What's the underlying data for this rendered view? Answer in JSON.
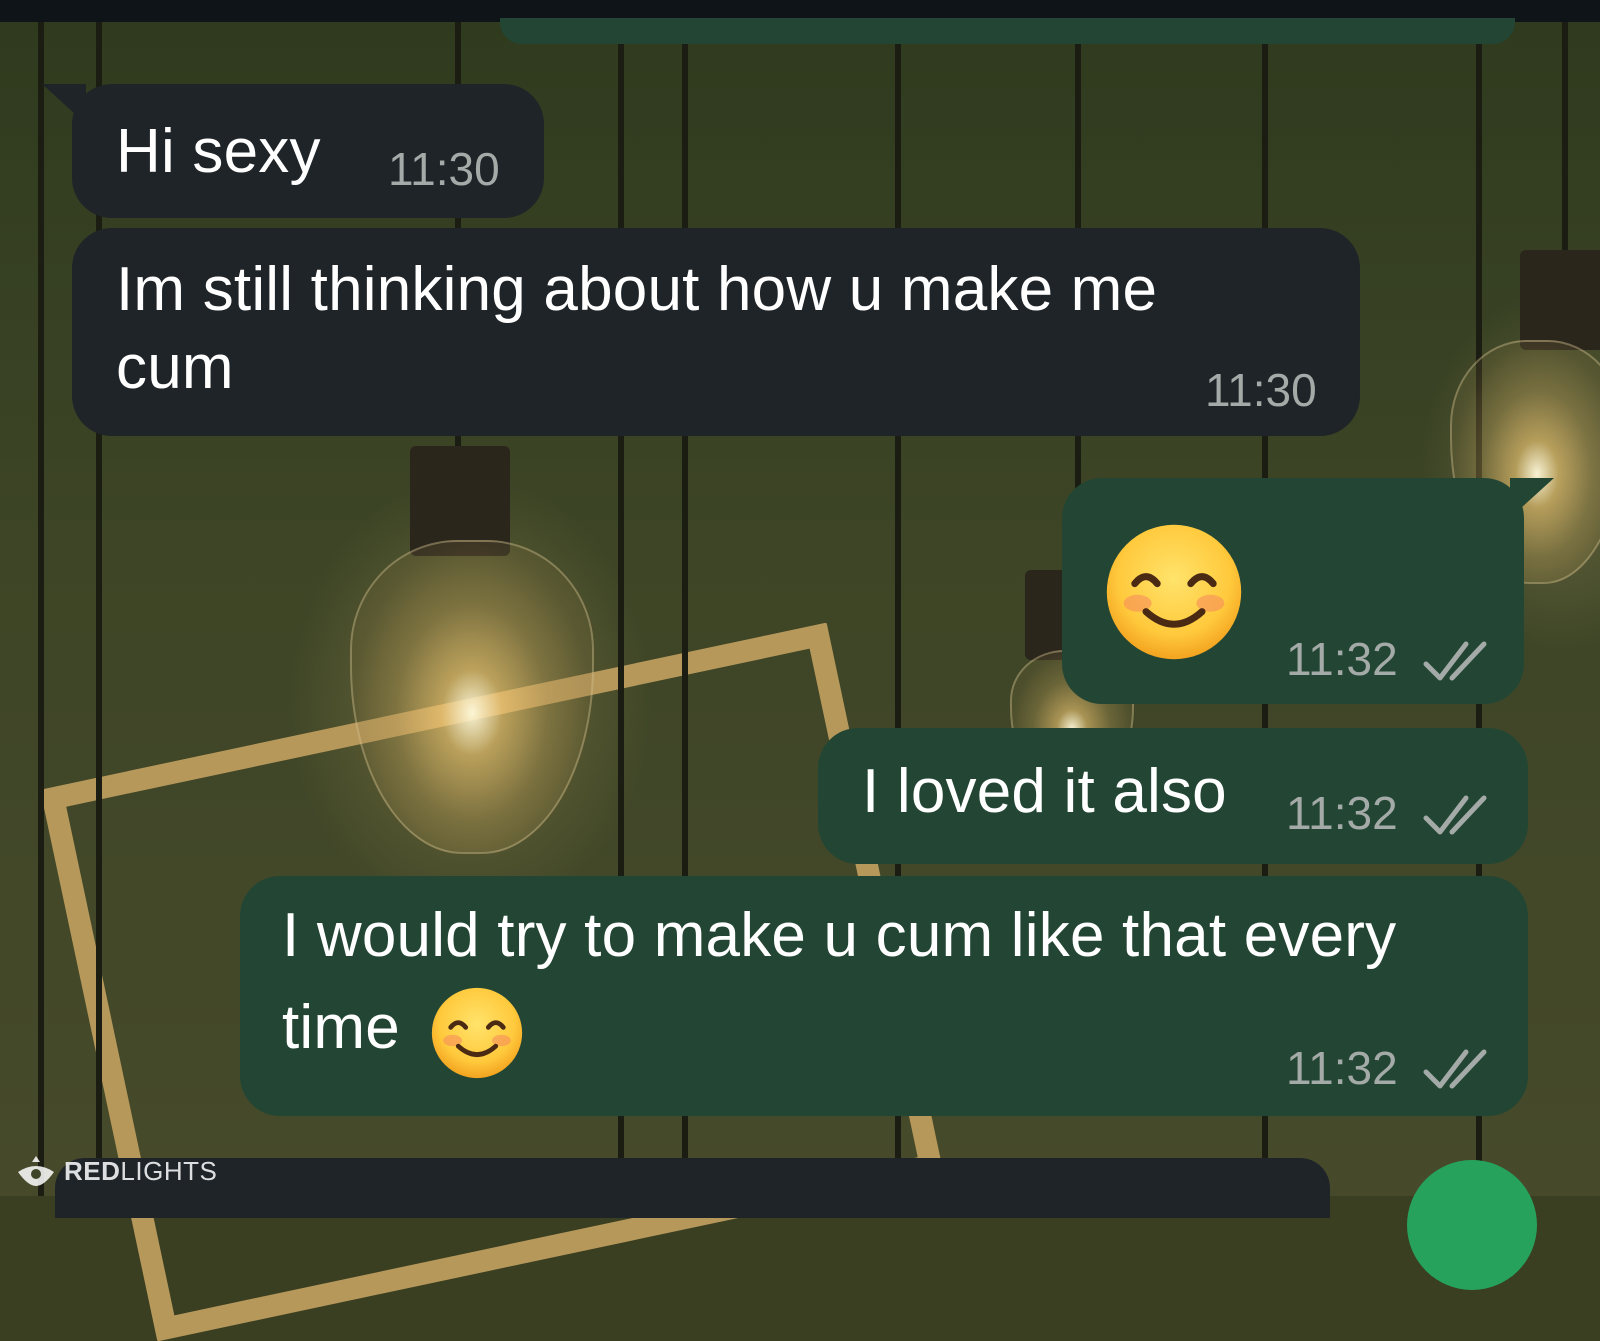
{
  "colors": {
    "incoming_bubble": "#1f2428",
    "outgoing_bubble": "#234634",
    "timestamp": "#a3aaa7",
    "send_button": "#27a25d"
  },
  "messages": [
    {
      "direction": "incoming",
      "text": "Hi sexy",
      "time": "11:30"
    },
    {
      "direction": "incoming",
      "line1": "Im still thinking about how u make me",
      "line2": "cum",
      "time": "11:30"
    },
    {
      "direction": "outgoing",
      "emoji": "smiling-face-with-smiling-eyes-icon",
      "time": "11:32",
      "status": "read"
    },
    {
      "direction": "outgoing",
      "text": "I loved it also",
      "time": "11:32",
      "status": "read"
    },
    {
      "direction": "outgoing",
      "line1": "I would try to make u cum like that every",
      "line2": "time",
      "emoji": "smiling-face-with-smiling-eyes-icon",
      "time": "11:32",
      "status": "read"
    }
  ],
  "watermark": {
    "brand_bold": "RED",
    "brand_light": "LIGHTS"
  }
}
